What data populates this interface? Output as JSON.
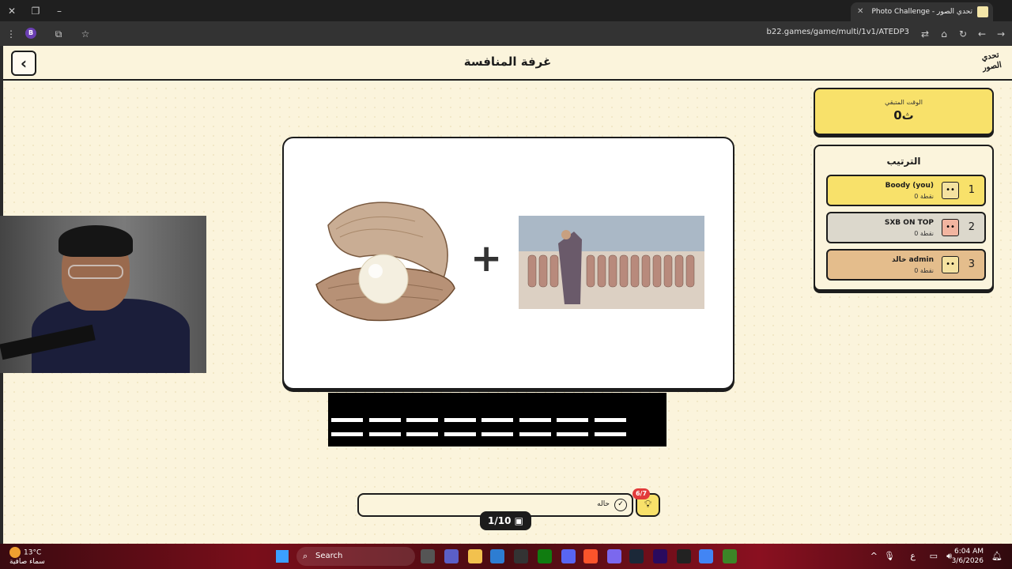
{
  "browser": {
    "tab_title": "Photo Challenge - تحدي الصور",
    "url": "b22.games/game/multi/1v1/ATEDP3",
    "profile_letter": "B"
  },
  "header": {
    "title": "غرفة المنافسة",
    "logo_text": "تحدي الصور"
  },
  "timer": {
    "label": "الوقت المتبقي",
    "value": "0ث"
  },
  "ranking": {
    "title": "الترتيب",
    "players": [
      {
        "rank": "1",
        "name": "Boody (you)",
        "points": "0 نقطة",
        "color": "#f8e16a"
      },
      {
        "rank": "2",
        "name": "SXB ON TOP",
        "points": "0 نقطة",
        "color": "#dcd8cc"
      },
      {
        "rank": "3",
        "name": "خالد admin",
        "points": "0 نقطة",
        "color": "#e4bd8c"
      }
    ]
  },
  "puzzle": {
    "operator": "+",
    "answer_slots": 16
  },
  "input": {
    "value": "حاله"
  },
  "hint": {
    "badge": "6/7"
  },
  "progress": {
    "text": "1/10"
  },
  "taskbar": {
    "temperature": "13°C",
    "weather_text": "سماء صافية",
    "search_label": "Search",
    "lang": "ع",
    "time": "6:04 AM",
    "date": "3/6/2026"
  }
}
